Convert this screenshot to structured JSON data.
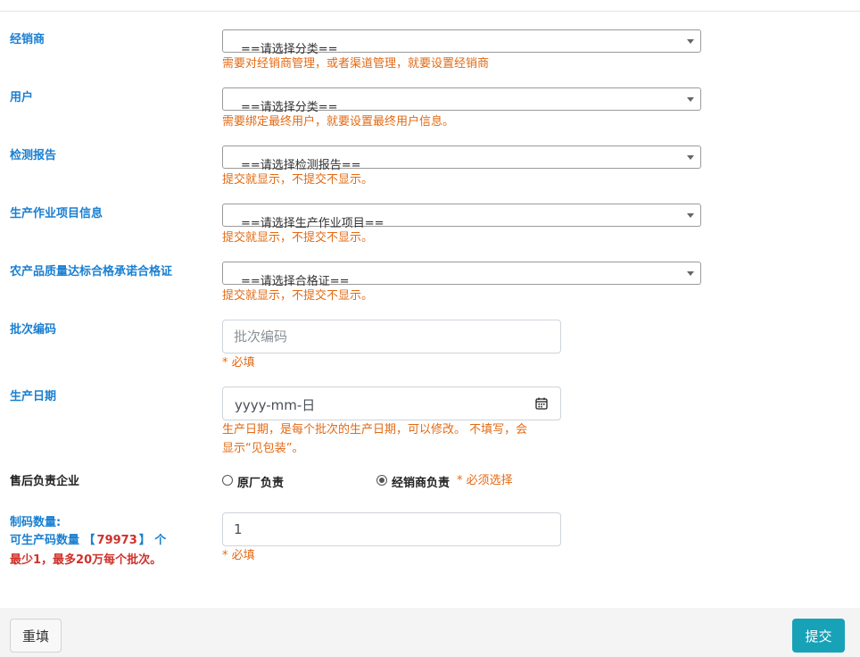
{
  "form": {
    "dealer": {
      "label": "经销商",
      "placeholder": "==请选择分类==",
      "hint": "需要对经销商管理，或者渠道管理，就要设置经销商"
    },
    "user": {
      "label": "用户",
      "placeholder": "==请选择分类==",
      "hint": "需要绑定最终用户，就要设置最终用户信息。"
    },
    "report": {
      "label": "检测报告",
      "placeholder": "==请选择检测报告==",
      "hint": "提交就显示，不提交不显示。"
    },
    "production": {
      "label": "生产作业项目信息",
      "placeholder": "==请选择生产作业项目==",
      "hint": "提交就显示，不提交不显示。"
    },
    "certificate": {
      "label": "农产品质量达标合格承诺合格证",
      "placeholder": "==请选择合格证==",
      "hint": "提交就显示，不提交不显示。"
    },
    "batch_code": {
      "label": "批次编码",
      "placeholder": "批次编码",
      "required": "* 必填"
    },
    "production_date": {
      "label": "生产日期",
      "placeholder": "yyyy-mm-日",
      "hint_line1": "生产日期，是每个批次的生产日期，可以修改。 不填写，会",
      "hint_line2": "显示“见包装”。"
    },
    "after_sales": {
      "label": "售后负责企业",
      "option1": "原厂负责",
      "option2": "经销商负责",
      "required": "* 必须选择",
      "selected": "经销商负责"
    },
    "code_count": {
      "label_line1": "制码数量:",
      "label_prefix": "可生产码数量 【",
      "available": "79973",
      "label_suffix": "】 个",
      "limit": "最少1，最多20万每个批次。",
      "value": "1",
      "required": "* 必填"
    }
  },
  "buttons": {
    "reset": "重填",
    "submit": "提交"
  },
  "colors": {
    "label_blue": "#1a7fd1",
    "hint_orange": "#e36a14",
    "limit_red": "#d0302b",
    "submit": "#17a2b8"
  }
}
